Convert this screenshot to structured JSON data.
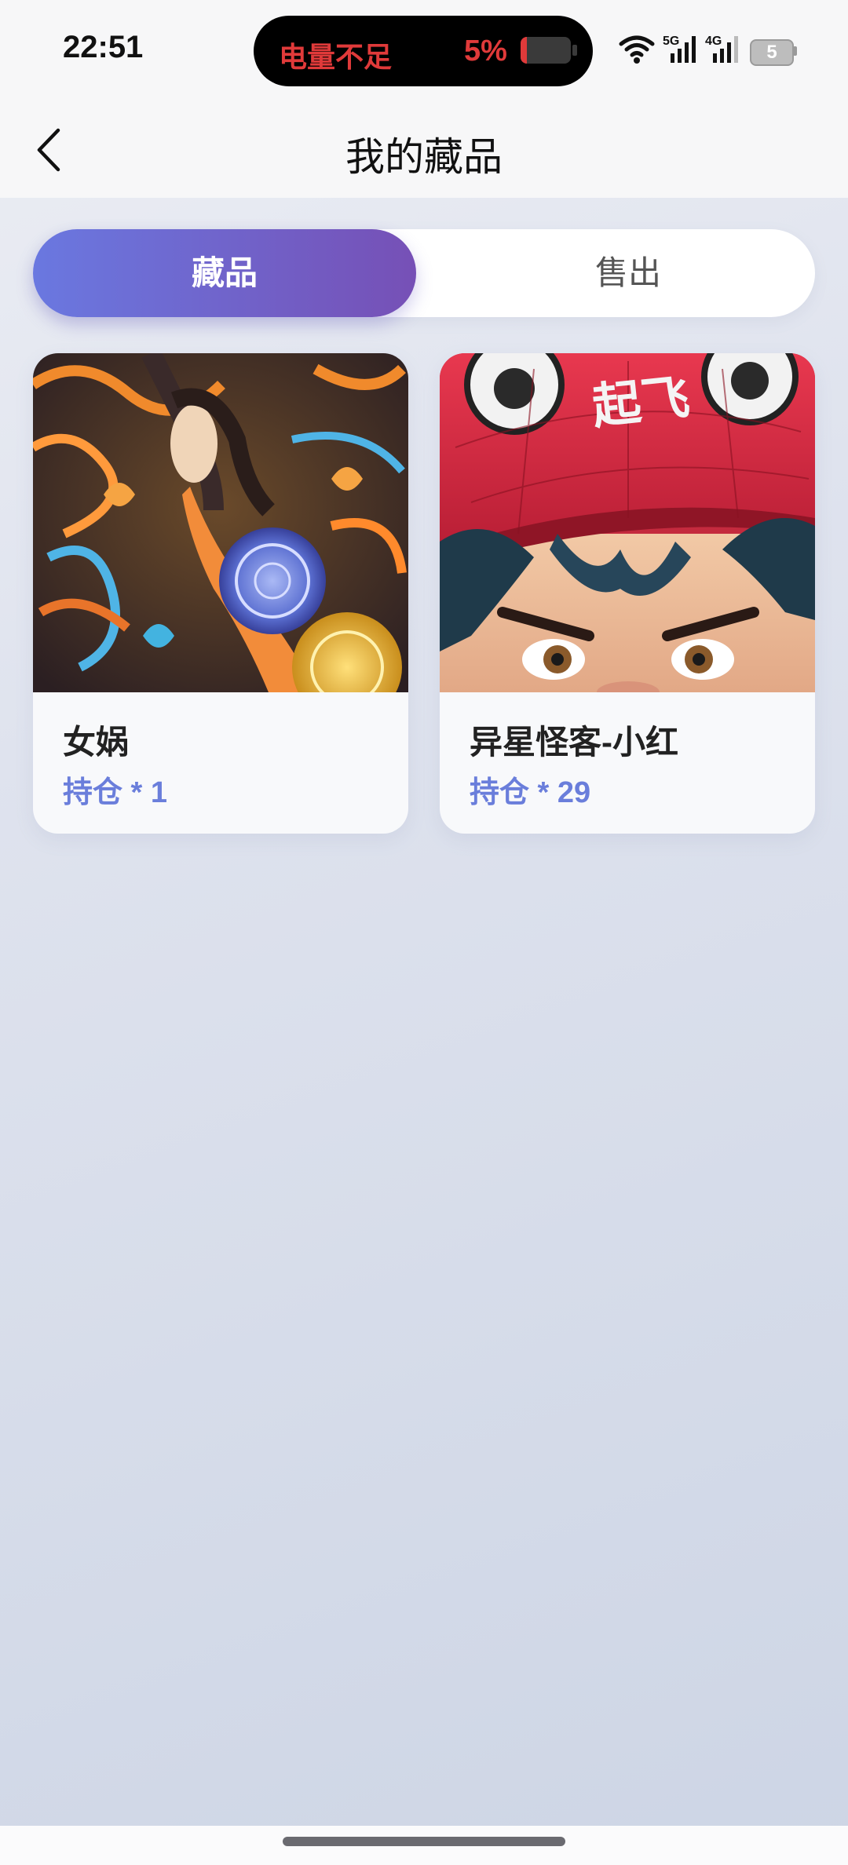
{
  "status_bar": {
    "time": "22:51",
    "low_power_text": "电量不足",
    "battery_percent": "5%",
    "battery_level": 0.05,
    "network_5g": "5G",
    "network_4g": "4G",
    "battery_badge": "5"
  },
  "header": {
    "back_icon": "chevron-left-icon",
    "title": "我的藏品"
  },
  "tabs": [
    {
      "label": "藏品",
      "active": true
    },
    {
      "label": "售出",
      "active": false
    }
  ],
  "collections": [
    {
      "name": "女娲",
      "holding": "持仓 * 1"
    },
    {
      "name": "异星怪客-小红",
      "holding": "持仓 * 29",
      "hat_text": "起飞"
    }
  ],
  "colors": {
    "accent": "#6a7edb",
    "tab_gradient_start": "#6a78e0",
    "tab_gradient_end": "#7650b6",
    "low_power": "#e03a3a"
  }
}
